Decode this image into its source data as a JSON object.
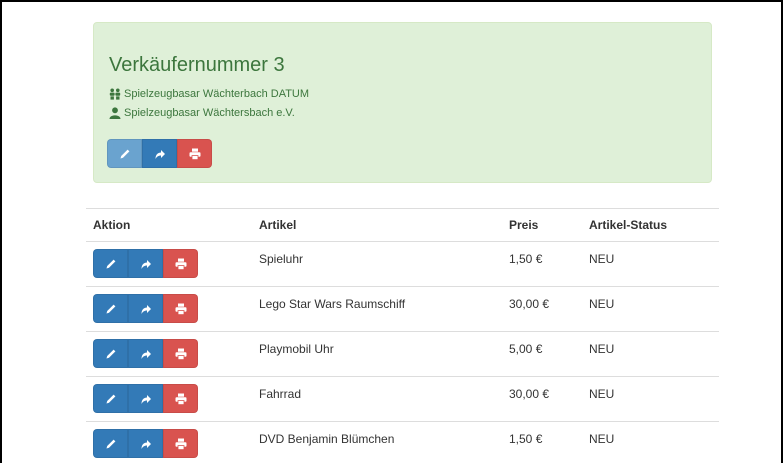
{
  "seller": {
    "title": "Verkäufernummer 3",
    "event": "Spielzeugbasar Wächterbach DATUM",
    "organizer": "Spielzeugbasar Wächtersbach e.V.",
    "event_icon": "users-icon",
    "organizer_icon": "user-icon"
  },
  "table": {
    "headers": [
      "Aktion",
      "Artikel",
      "Preis",
      "Artikel-Status"
    ],
    "rows": [
      {
        "artikel": "Spieluhr",
        "preis": "1,50 €",
        "status": "NEU"
      },
      {
        "artikel": "Lego Star Wars Raumschiff",
        "preis": "30,00 €",
        "status": "NEU"
      },
      {
        "artikel": "Playmobil Uhr",
        "preis": "5,00 €",
        "status": "NEU"
      },
      {
        "artikel": "Fahrrad",
        "preis": "30,00 €",
        "status": "NEU"
      },
      {
        "artikel": "DVD Benjamin Blümchen",
        "preis": "1,50 €",
        "status": "NEU"
      }
    ]
  },
  "colors": {
    "panel_bg": "#dff0d8",
    "panel_text": "#3c763d",
    "primary": "#337ab7",
    "danger": "#d9534f"
  }
}
